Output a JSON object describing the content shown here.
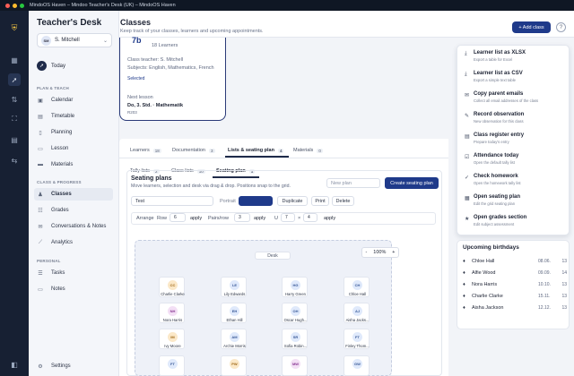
{
  "window": {
    "title": "MindoOS Haven – Mindoo Teacher's Desk (UK) – MindoOS Haven",
    "colors": {
      "close": "#ff5f57",
      "min": "#febc2e",
      "max": "#28c840"
    }
  },
  "rail": {
    "icons": [
      "shield-logo-icon",
      "grid-icon",
      "rocket-icon",
      "transfer-icon",
      "scan-icon",
      "report-icon",
      "sliders-icon",
      "sidebar-toggle-icon"
    ]
  },
  "sidebar": {
    "brand": "Teacher's Desk",
    "user": {
      "initials": "SM",
      "name": "S. Mitchell"
    },
    "today": "Today",
    "sections": {
      "plan": "PLAN & TEACH",
      "class": "CLASS & PROGRESS",
      "personal": "PERSONAL"
    },
    "plan_items": [
      "Calendar",
      "Timetable",
      "Planning",
      "Lesson",
      "Materials"
    ],
    "class_items": [
      "Classes",
      "Grades",
      "Conversations & Notes",
      "Analytics"
    ],
    "personal_items": [
      "Tasks",
      "Notes"
    ],
    "settings": "Settings"
  },
  "header": {
    "title": "Classes",
    "subtitle": "Keep track of your classes, learners and upcoming appointments.",
    "add_button": "+ Add class",
    "help": "?"
  },
  "class_card": {
    "name": "7b",
    "learners": "18 Learners",
    "teacher": "Class teacher: S. Mitchell",
    "subjects": "Subjects: English, Mathematics, French",
    "status": "Selected",
    "next_lesson_label": "Next lesson",
    "next_lesson": "Do, 3. Std. · Mathematik",
    "room": "R203"
  },
  "tabs": [
    {
      "label": "Learners",
      "count": "18"
    },
    {
      "label": "Documentation",
      "count": "3"
    },
    {
      "label": "Lists & seating plan",
      "count": "4"
    },
    {
      "label": "Materials",
      "count": "0"
    }
  ],
  "subtabs": [
    {
      "label": "Tally lists",
      "count": "2"
    },
    {
      "label": "Class lists",
      "count": "10"
    },
    {
      "label": "Seating plan",
      "count": "1"
    }
  ],
  "seating": {
    "title": "Seating plans",
    "subtitle": "Move learners, selection and desk via drag & drop. Positions snap to the grid.",
    "new_plan_placeholder": "New plan",
    "create_button": "Create seating plan",
    "plan_name": "Test",
    "orientation_label": "Portrait",
    "duplicate": "Duplicate",
    "print": "Print",
    "delete": "Delete",
    "arrange": {
      "label": "Arrange",
      "row_label": "Row",
      "row_value": "6",
      "apply1": "apply",
      "pairs_label": "Pairs/row",
      "pairs_value": "3",
      "apply2": "apply",
      "u_label": "U",
      "u_a": "7",
      "times": "×",
      "u_b": "4",
      "apply3": "apply"
    },
    "zoom": {
      "minus": "-",
      "value": "100%",
      "plus": "+"
    },
    "desk_label": "Desk",
    "students": [
      {
        "initials": "CC",
        "name": "Charlie Clarke",
        "color": "#fbe8c8",
        "ink": "#a06a1a"
      },
      {
        "initials": "LE",
        "name": "Lily Edwards",
        "color": "#dfe9fb",
        "ink": "#3a5a98"
      },
      {
        "initials": "HG",
        "name": "Harry Green",
        "color": "#dfe9fb",
        "ink": "#3a5a98"
      },
      {
        "initials": "CH",
        "name": "Chloe Hall",
        "color": "#dfe9fb",
        "ink": "#3a5a98"
      },
      {
        "initials": "NH",
        "name": "Nora Harris",
        "color": "#f3dff5",
        "ink": "#8a3a94"
      },
      {
        "initials": "EH",
        "name": "Ethan Hill",
        "color": "#dfe9fb",
        "ink": "#3a5a98"
      },
      {
        "initials": "OH",
        "name": "Oscar Hugh...",
        "color": "#dfe9fb",
        "ink": "#3a5a98"
      },
      {
        "initials": "AJ",
        "name": "Aisha Jacks...",
        "color": "#dfe9fb",
        "ink": "#3a5a98"
      },
      {
        "initials": "IM",
        "name": "Ivy Moore",
        "color": "#fbe8c8",
        "ink": "#a06a1a"
      },
      {
        "initials": "AM",
        "name": "Archie Morris",
        "color": "#dfe9fb",
        "ink": "#3a5a98"
      },
      {
        "initials": "SR",
        "name": "Sofia Robin...",
        "color": "#dfe9fb",
        "ink": "#3a5a98"
      },
      {
        "initials": "FT",
        "name": "Finley Thom...",
        "color": "#dfe9fb",
        "ink": "#3a5a98"
      },
      {
        "initials": "FT",
        "name": "",
        "color": "#dfe9fb",
        "ink": "#3a5a98"
      },
      {
        "initials": "PW",
        "name": "",
        "color": "#fbe8c8",
        "ink": "#a06a1a"
      },
      {
        "initials": "MW",
        "name": "",
        "color": "#f3dff5",
        "ink": "#8a3a94"
      },
      {
        "initials": "GW",
        "name": "",
        "color": "#dfe9fb",
        "ink": "#3a5a98"
      }
    ]
  },
  "menu": [
    {
      "icon": "download-icon",
      "title": "Learner list as XLSX",
      "sub": "Export a table for Excel"
    },
    {
      "icon": "download-icon",
      "title": "Learner list as CSV",
      "sub": "Export a simple text table"
    },
    {
      "icon": "mail-icon",
      "title": "Copy parent emails",
      "sub": "Collect all email addresses of the class"
    },
    {
      "icon": "note-icon",
      "title": "Record observation",
      "sub": "New observation for this class"
    },
    {
      "icon": "register-icon",
      "title": "Class register entry",
      "sub": "Prepare today's entry"
    },
    {
      "icon": "attendance-icon",
      "title": "Attendance today",
      "sub": "Open the default tally list"
    },
    {
      "icon": "check-icon",
      "title": "Check homework",
      "sub": "Open the homework tally list"
    },
    {
      "icon": "seat-icon",
      "title": "Open seating plan",
      "sub": "Edit the grid seating plan"
    },
    {
      "icon": "grade-icon",
      "title": "Open grades section",
      "sub": "Edit subject assessment"
    }
  ],
  "birthdays": {
    "title": "Upcoming birthdays",
    "rows": [
      {
        "name": "Chloe Hall",
        "date": "08.06.",
        "age": "13"
      },
      {
        "name": "Alfie Wood",
        "date": "09.09.",
        "age": "14"
      },
      {
        "name": "Nora Harris",
        "date": "10.10.",
        "age": "13"
      },
      {
        "name": "Charlie Clarke",
        "date": "15.11.",
        "age": "13"
      },
      {
        "name": "Aisha Jackson",
        "date": "12.12.",
        "age": "13"
      }
    ]
  }
}
